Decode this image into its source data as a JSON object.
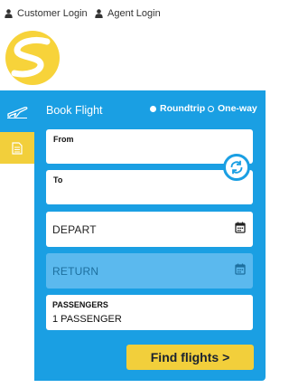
{
  "header": {
    "customer_login": "Customer Login",
    "agent_login": "Agent Login"
  },
  "sidebar": {
    "tabs": [
      {
        "icon": "airplane-icon",
        "active": true
      },
      {
        "icon": "document-icon",
        "active": false
      }
    ]
  },
  "booking": {
    "title": "Book Flight",
    "trip_type": {
      "options": [
        "Roundtrip",
        "One-way"
      ],
      "selected": "Roundtrip"
    },
    "from_label": "From",
    "to_label": "To",
    "depart_label": "DEPART",
    "return_label": "RETURN",
    "passengers_label": "PASSENGERS",
    "passengers_value": "1 PASSENGER",
    "submit_label": "Find flights >"
  },
  "colors": {
    "panel_blue": "#1a9fe3",
    "return_blue": "#5bb9ee",
    "accent_yellow": "#f2cf3b"
  }
}
